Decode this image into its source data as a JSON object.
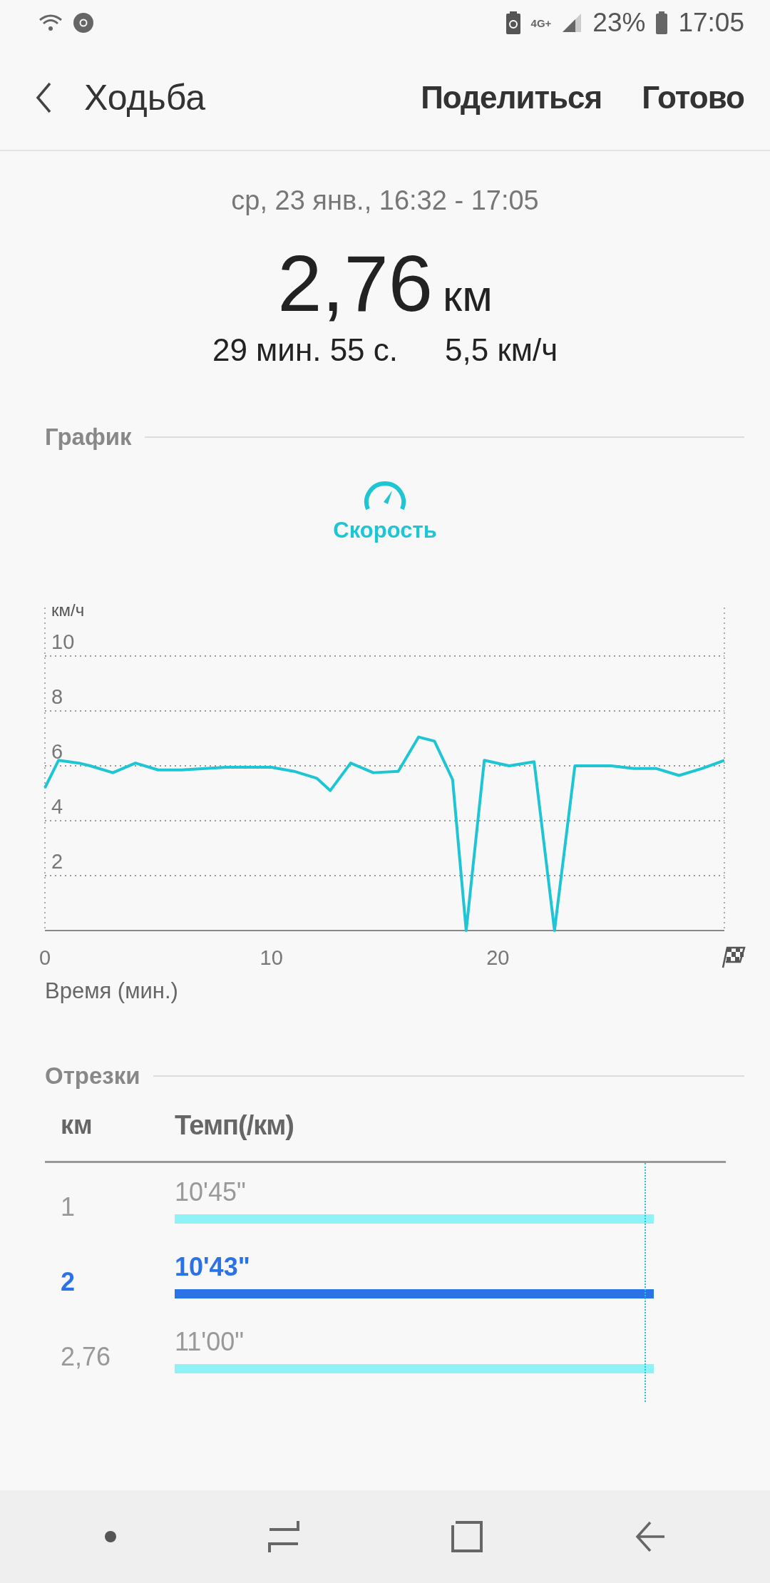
{
  "status_bar": {
    "network_type": "4G+",
    "battery": "23%",
    "time": "17:05"
  },
  "app_bar": {
    "title": "Ходьба",
    "actions": [
      "Поделиться",
      "Готово"
    ]
  },
  "summary": {
    "date_range": "ср, 23 янв., 16:32 - 17:05",
    "distance": "2,76",
    "distance_unit": "км",
    "duration": "29 мин. 55 с.",
    "speed": "5,5 км/ч"
  },
  "graph_section": {
    "title": "График",
    "chart_data": {
      "type": "line",
      "grid": true,
      "xlabel": "Время (мин.)",
      "ylabel": "км/ч",
      "xlim": [
        0,
        30
      ],
      "ylim": [
        0,
        10
      ],
      "xticks": [
        0,
        10,
        20
      ],
      "yticks": [
        2,
        4,
        6,
        8,
        10
      ],
      "x": [
        0,
        0.6,
        1.5,
        2,
        3,
        4,
        5,
        6,
        8,
        10,
        11,
        12,
        12.6,
        13.5,
        14.5,
        15.6,
        16.5,
        17.2,
        18,
        18.6,
        19.4,
        20.5,
        21.6,
        22.5,
        23.4,
        25,
        26,
        27,
        28,
        29,
        30
      ],
      "series": [
        {
          "name": "Скорость",
          "color": "#1ec5d3",
          "values": [
            5.2,
            6.2,
            6.1,
            6.0,
            5.75,
            6.1,
            5.85,
            5.85,
            5.95,
            5.95,
            5.8,
            5.55,
            5.1,
            6.1,
            5.75,
            5.8,
            7.05,
            6.9,
            5.5,
            0,
            6.2,
            6.0,
            6.15,
            0,
            6.0,
            6.0,
            5.9,
            5.9,
            5.65,
            5.9,
            6.2
          ]
        }
      ]
    }
  },
  "splits_section": {
    "title": "Отрезки",
    "columns": [
      "км",
      "Темп(/км)"
    ],
    "rows": [
      {
        "km": "1",
        "pace": "10'45\"",
        "selected": false
      },
      {
        "km": "2",
        "pace": "10'43\"",
        "selected": true
      },
      {
        "km": "2,76",
        "pace": "11'00\"",
        "selected": false
      }
    ]
  }
}
